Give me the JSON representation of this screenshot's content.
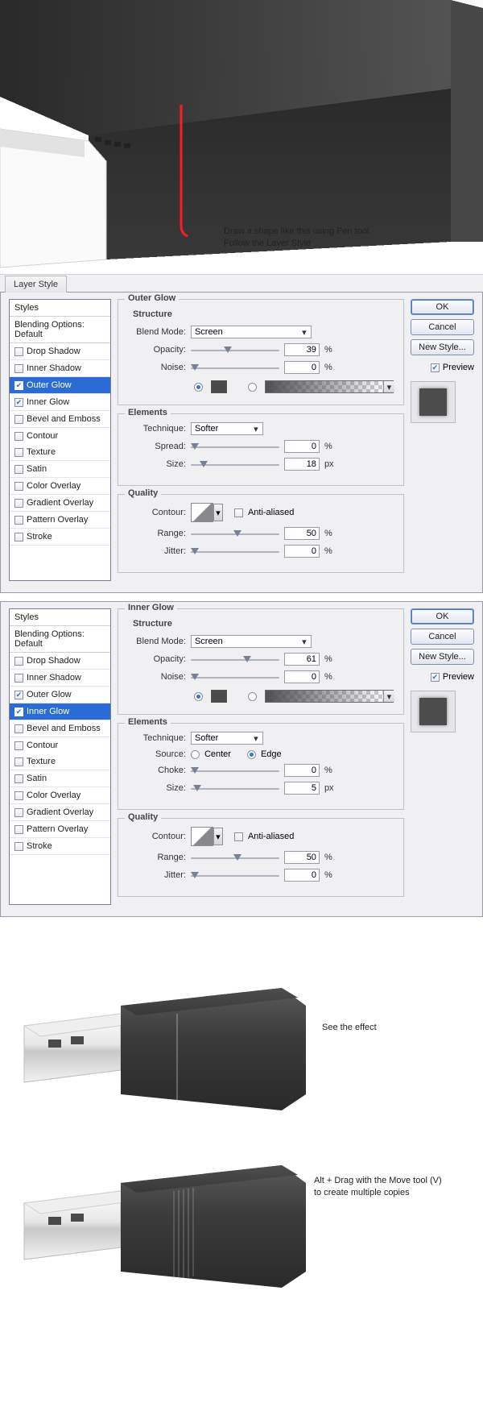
{
  "illus1": {
    "line1": "Draw a shape like this using Pen tool.",
    "line2": "Follow the Layer Style"
  },
  "tab_label": "Layer Style",
  "styles_header": "Styles",
  "blending_default": "Blending Options: Default",
  "effects": [
    {
      "label": "Drop Shadow"
    },
    {
      "label": "Inner Shadow"
    },
    {
      "label": "Outer Glow"
    },
    {
      "label": "Inner Glow"
    },
    {
      "label": "Bevel and Emboss"
    },
    {
      "label": "Contour",
      "indent": true
    },
    {
      "label": "Texture",
      "indent": true
    },
    {
      "label": "Satin"
    },
    {
      "label": "Color Overlay"
    },
    {
      "label": "Gradient Overlay"
    },
    {
      "label": "Pattern Overlay"
    },
    {
      "label": "Stroke"
    }
  ],
  "buttons": {
    "ok": "OK",
    "cancel": "Cancel",
    "newstyle": "New Style...",
    "preview": "Preview"
  },
  "group_titles": {
    "structure": "Structure",
    "elements": "Elements",
    "quality": "Quality"
  },
  "labels": {
    "blend_mode": "Blend Mode:",
    "opacity": "Opacity:",
    "noise": "Noise:",
    "technique": "Technique:",
    "spread": "Spread:",
    "size": "Size:",
    "source": "Source:",
    "center": "Center",
    "edge": "Edge",
    "choke": "Choke:",
    "contour": "Contour:",
    "anti": "Anti-aliased",
    "range": "Range:",
    "jitter": "Jitter:",
    "percent": "%",
    "px": "px"
  },
  "dlg1": {
    "title": "Outer Glow",
    "checked": [
      2,
      3
    ],
    "active": 2,
    "blend_mode": "Screen",
    "opacity": 39,
    "noise": 0,
    "technique": "Softer",
    "spread": 0,
    "size": 18,
    "range": 50,
    "jitter": 0
  },
  "dlg2": {
    "title": "Inner Glow",
    "checked": [
      2,
      3
    ],
    "active": 3,
    "blend_mode": "Screen",
    "opacity": 61,
    "noise": 0,
    "technique": "Softer",
    "source": "edge",
    "choke": 0,
    "size": 5,
    "range": 50,
    "jitter": 0
  },
  "illus2": {
    "effect": "See the effect",
    "copy1": "Alt + Drag with the Move tool (V)",
    "copy2": "to create multiple copies"
  }
}
